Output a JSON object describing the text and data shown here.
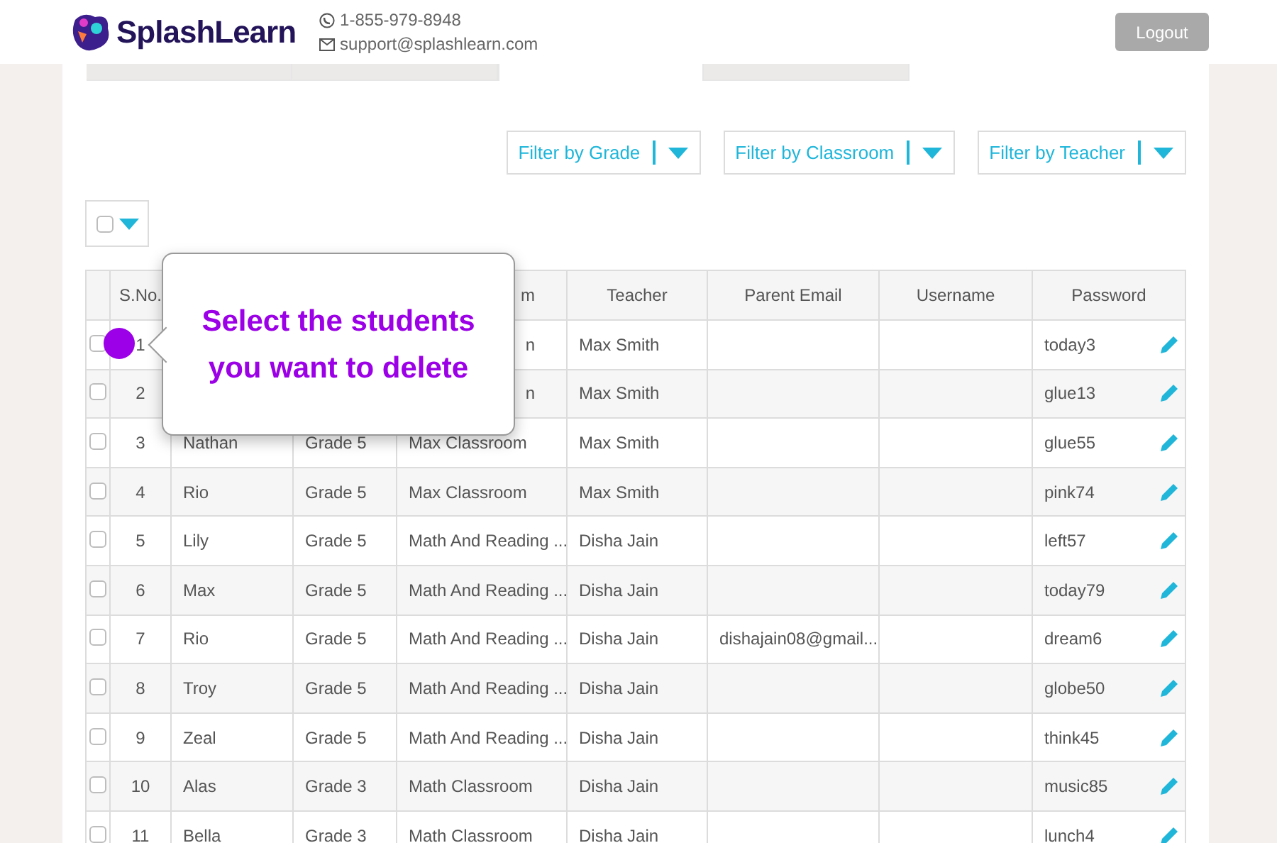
{
  "header": {
    "brand": "SplashLearn",
    "phone": "1-855-979-8948",
    "email": "support@splashlearn.com",
    "logout": "Logout"
  },
  "tabs": [
    {
      "selected": false
    },
    {
      "selected": false
    },
    {
      "selected": true
    },
    {
      "selected": false
    }
  ],
  "filters": [
    "Filter by Grade",
    "Filter by Classroom",
    "Filter by Teacher"
  ],
  "bulk_select": {
    "checked": false
  },
  "table": {
    "columns": [
      "S.No.",
      null,
      null,
      "m",
      "Teacher",
      "Parent Email",
      "Username",
      "Password"
    ],
    "rows": [
      {
        "checked": false,
        "cells": [
          "1",
          null,
          null,
          "n",
          "Max Smith",
          null,
          null,
          "today3"
        ]
      },
      {
        "checked": false,
        "cells": [
          "2",
          null,
          null,
          "n",
          "Max Smith",
          null,
          null,
          "glue13"
        ]
      },
      {
        "checked": false,
        "cells": [
          "3",
          "Nathan",
          "Grade 5",
          "Max Classroom",
          "Max Smith",
          null,
          null,
          "glue55"
        ]
      },
      {
        "checked": false,
        "cells": [
          "4",
          "Rio",
          "Grade 5",
          "Max Classroom",
          "Max Smith",
          null,
          null,
          "pink74"
        ]
      },
      {
        "checked": false,
        "cells": [
          "5",
          "Lily",
          "Grade 5",
          "Math And Reading ...",
          "Disha Jain",
          null,
          null,
          "left57"
        ]
      },
      {
        "checked": false,
        "cells": [
          "6",
          "Max",
          "Grade 5",
          "Math And Reading ...",
          "Disha Jain",
          null,
          null,
          "today79"
        ]
      },
      {
        "checked": false,
        "cells": [
          "7",
          "Rio",
          "Grade 5",
          "Math And Reading ...",
          "Disha Jain",
          "dishajain08@gmail....",
          null,
          "dream6"
        ]
      },
      {
        "checked": false,
        "cells": [
          "8",
          "Troy",
          "Grade 5",
          "Math And Reading ...",
          "Disha Jain",
          null,
          null,
          "globe50"
        ]
      },
      {
        "checked": false,
        "cells": [
          "9",
          "Zeal",
          "Grade 5",
          "Math And Reading ...",
          "Disha Jain",
          null,
          null,
          "think45"
        ]
      },
      {
        "checked": false,
        "cells": [
          "10",
          "Alas",
          "Grade 3",
          "Math Classroom",
          "Disha Jain",
          null,
          null,
          "music85"
        ]
      },
      {
        "checked": false,
        "cells": [
          "11",
          "Bella",
          "Grade 3",
          "Math Classroom",
          "Disha Jain",
          null,
          null,
          "lunch4"
        ]
      }
    ]
  },
  "tooltip": {
    "text": "Select the students you want to delete"
  }
}
